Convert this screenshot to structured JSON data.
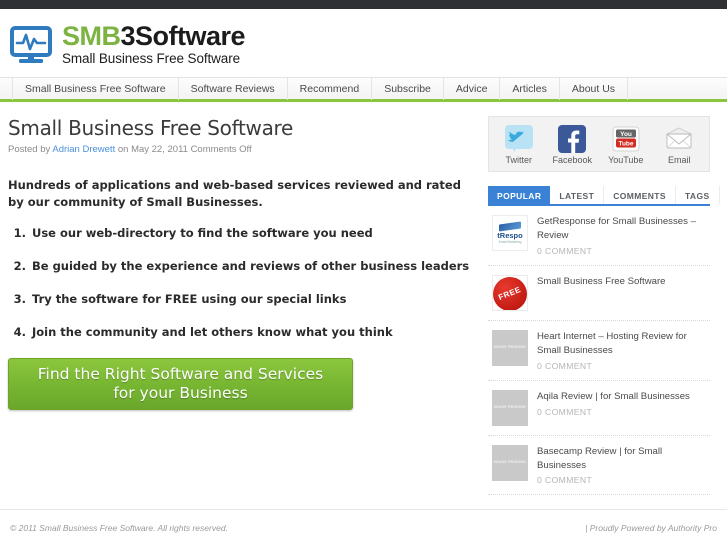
{
  "topbar": {
    "present": true,
    "color": "#2f3033"
  },
  "header": {
    "logo": {
      "icon_name": "monitor-pulse-icon",
      "brand_green": "SMB",
      "brand_black": "3Software",
      "tagline": "Small Business Free Software",
      "green_hex": "#7cb342"
    }
  },
  "nav": {
    "items": [
      {
        "label": "Small Business Free Software"
      },
      {
        "label": "Software Reviews"
      },
      {
        "label": "Recommend"
      },
      {
        "label": "Subscribe"
      },
      {
        "label": "Advice"
      },
      {
        "label": "Articles"
      },
      {
        "label": "About Us"
      }
    ],
    "accent_hex": "#8cc63e"
  },
  "article": {
    "title": "Small Business Free Software",
    "byline_prefix": "Posted by ",
    "byline_author": "Adrian Drewett",
    "byline_suffix": " on May 22, 2011 Comments Off",
    "lede": "Hundreds of applications and web-based services reviewed and rated by our community of Small Businesses.",
    "points": [
      "Use our web-directory to find the software you need",
      "Be guided by the experience and reviews of other business leaders",
      "Try the software for FREE using our special links",
      "Join the community and let others know what you think"
    ],
    "cta": {
      "line1": "Find the Right Software and Services",
      "line2": "for your Business",
      "color_hex": "#76b531"
    }
  },
  "sidebar": {
    "social": [
      {
        "label": "Twitter",
        "icon_name": "twitter-bird-icon",
        "color": "#8ccdea"
      },
      {
        "label": "Facebook",
        "icon_name": "facebook-f-icon",
        "color": "#3b5998"
      },
      {
        "label": "YouTube",
        "icon_name": "youtube-icon",
        "color": "#ffffff"
      },
      {
        "label": "Email",
        "icon_name": "envelope-icon",
        "color": "#ffffff"
      }
    ],
    "tabs": [
      {
        "label": "POPULAR",
        "active": true
      },
      {
        "label": "LATEST",
        "active": false
      },
      {
        "label": "COMMENTS",
        "active": false
      },
      {
        "label": "TAGS",
        "active": false
      }
    ],
    "tab_accent_hex": "#3b82d6",
    "popular": [
      {
        "title": "GetResponse for Small Businesses – Review",
        "meta": "0 COMMENT",
        "thumb_type": "getresponse",
        "thumb_text": "tRespo",
        "thumb_sub": "Email Marketing"
      },
      {
        "title": "Small Business Free Software",
        "meta": "",
        "thumb_type": "free-badge",
        "thumb_text": "FREE"
      },
      {
        "title": "Heart Internet – Hosting Review for Small Businesses",
        "meta": "0 COMMENT",
        "thumb_type": "pending",
        "thumb_text": "IMAGE PENDING"
      },
      {
        "title": "Aqila Review | for Small Businesses",
        "meta": "0 COMMENT",
        "thumb_type": "pending",
        "thumb_text": "IMAGE PENDING"
      },
      {
        "title": "Basecamp Review | for Small Businesses",
        "meta": "0 COMMENT",
        "thumb_type": "pending",
        "thumb_text": "IMAGE PENDING"
      }
    ]
  },
  "footer": {
    "left": "© 2011 Small Business Free Software. All rights reserved.",
    "right": "| Proudly Powered by Authority Pro"
  }
}
